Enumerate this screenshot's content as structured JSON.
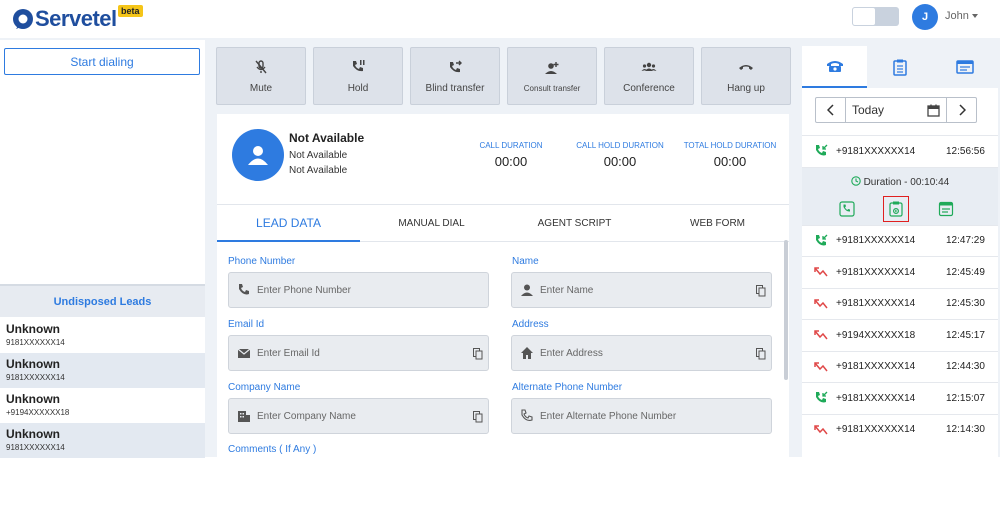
{
  "header": {
    "brand": "Servetel",
    "beta": "beta",
    "user_initial": "J",
    "user_name": "John"
  },
  "left": {
    "start_dialing": "Start dialing",
    "undisposed_title": "Undisposed Leads",
    "leads": [
      {
        "name": "Unknown",
        "number": "9181XXXXXX14"
      },
      {
        "name": "Unknown",
        "number": "9181XXXXXX14"
      },
      {
        "name": "Unknown",
        "number": "+9194XXXXXX18"
      },
      {
        "name": "Unknown",
        "number": "9181XXXXXX14"
      }
    ]
  },
  "controls": [
    {
      "label": "Mute",
      "icon": "mic-off-icon"
    },
    {
      "label": "Hold",
      "icon": "phone-pause-icon"
    },
    {
      "label": "Blind transfer",
      "icon": "phone-forward-icon"
    },
    {
      "label": "Consult transfer",
      "icon": "person-add-icon"
    },
    {
      "label": "Conference",
      "icon": "group-icon"
    },
    {
      "label": "Hang up",
      "icon": "call-end-icon"
    }
  ],
  "status": {
    "title": "Not Available",
    "line1": "Not Available",
    "line2": "Not Available",
    "call_duration_label": "CALL DURATION",
    "call_duration": "00:00",
    "call_hold_label": "CALL HOLD DURATION",
    "call_hold": "00:00",
    "total_hold_label": "TOTAL HOLD DURATION",
    "total_hold": "00:00"
  },
  "tabs": [
    "LEAD DATA",
    "MANUAL DIAL",
    "AGENT SCRIPT",
    "WEB FORM"
  ],
  "form": {
    "phone_label": "Phone Number",
    "phone_placeholder": "Enter Phone Number",
    "name_label": "Name",
    "name_placeholder": "Enter Name",
    "email_label": "Email Id",
    "email_placeholder": "Enter Email Id",
    "address_label": "Address",
    "address_placeholder": "Enter Address",
    "company_label": "Company Name",
    "company_placeholder": "Enter Company Name",
    "alt_phone_label": "Alternate Phone Number",
    "alt_phone_placeholder": "Enter Alternate Phone Number",
    "comments_label": "Comments ( If Any )"
  },
  "right": {
    "date_label": "Today",
    "expanded_duration": "Duration - 00:10:44",
    "calls": [
      {
        "number": "+9181XXXXXX14",
        "time": "12:56:56",
        "type": "incoming"
      },
      {
        "number": "+9181XXXXXX14",
        "time": "12:47:29",
        "type": "incoming"
      },
      {
        "number": "+9181XXXXXX14",
        "time": "12:45:49",
        "type": "missed"
      },
      {
        "number": "+9181XXXXXX14",
        "time": "12:45:30",
        "type": "missed"
      },
      {
        "number": "+9194XXXXXX18",
        "time": "12:45:17",
        "type": "missed"
      },
      {
        "number": "+9181XXXXXX14",
        "time": "12:44:30",
        "type": "missed"
      },
      {
        "number": "+9181XXXXXX14",
        "time": "12:15:07",
        "type": "incoming"
      },
      {
        "number": "+9181XXXXXX14",
        "time": "12:14:30",
        "type": "missed"
      }
    ]
  },
  "colors": {
    "accent": "#2e7be0",
    "brand": "#1f4e9e",
    "incoming": "#1faa59",
    "missed": "#e04848",
    "highlight": "#e02020"
  }
}
